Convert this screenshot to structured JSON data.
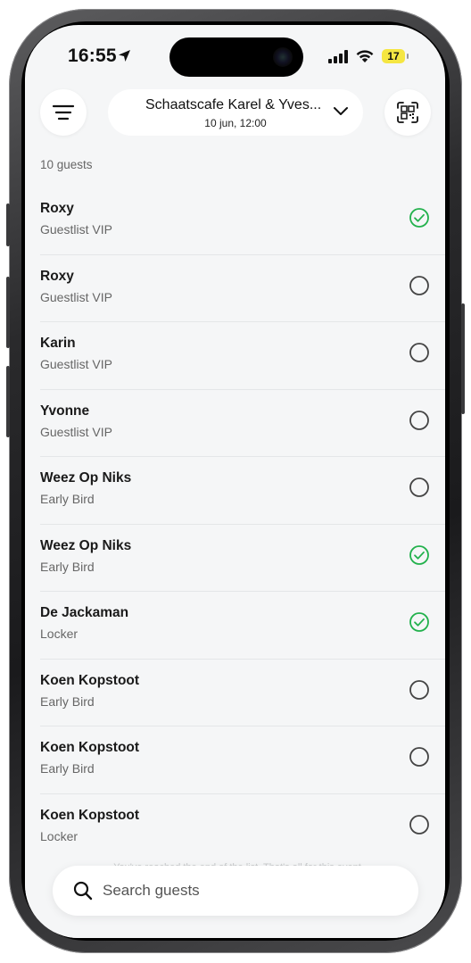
{
  "status_bar": {
    "time": "16:55",
    "battery": "17"
  },
  "header": {
    "event_name": "Schaatscafe Karel & Yves...",
    "event_date": "10 jun, 12:00"
  },
  "guest_count": "10 guests",
  "guests": [
    {
      "name": "Roxy",
      "type": "Guestlist VIP",
      "checked_in": true
    },
    {
      "name": "Roxy",
      "type": "Guestlist VIP",
      "checked_in": false
    },
    {
      "name": "Karin",
      "type": "Guestlist VIP",
      "checked_in": false
    },
    {
      "name": "Yvonne",
      "type": "Guestlist VIP",
      "checked_in": false
    },
    {
      "name": "Weez Op Niks",
      "type": "Early Bird",
      "checked_in": false
    },
    {
      "name": "Weez Op Niks",
      "type": "Early Bird",
      "checked_in": true
    },
    {
      "name": "De Jackaman",
      "type": "Locker",
      "checked_in": true
    },
    {
      "name": "Koen Kopstoot",
      "type": "Early Bird",
      "checked_in": false
    },
    {
      "name": "Koen Kopstoot",
      "type": "Early Bird",
      "checked_in": false
    },
    {
      "name": "Koen Kopstoot",
      "type": "Locker",
      "checked_in": false
    }
  ],
  "end_of_list": "You've reached the end of the list. That's all for this event",
  "search": {
    "placeholder": "Search guests"
  },
  "colors": {
    "checked": "#22b14c",
    "unchecked": "#444444",
    "background": "#f5f6f7"
  }
}
